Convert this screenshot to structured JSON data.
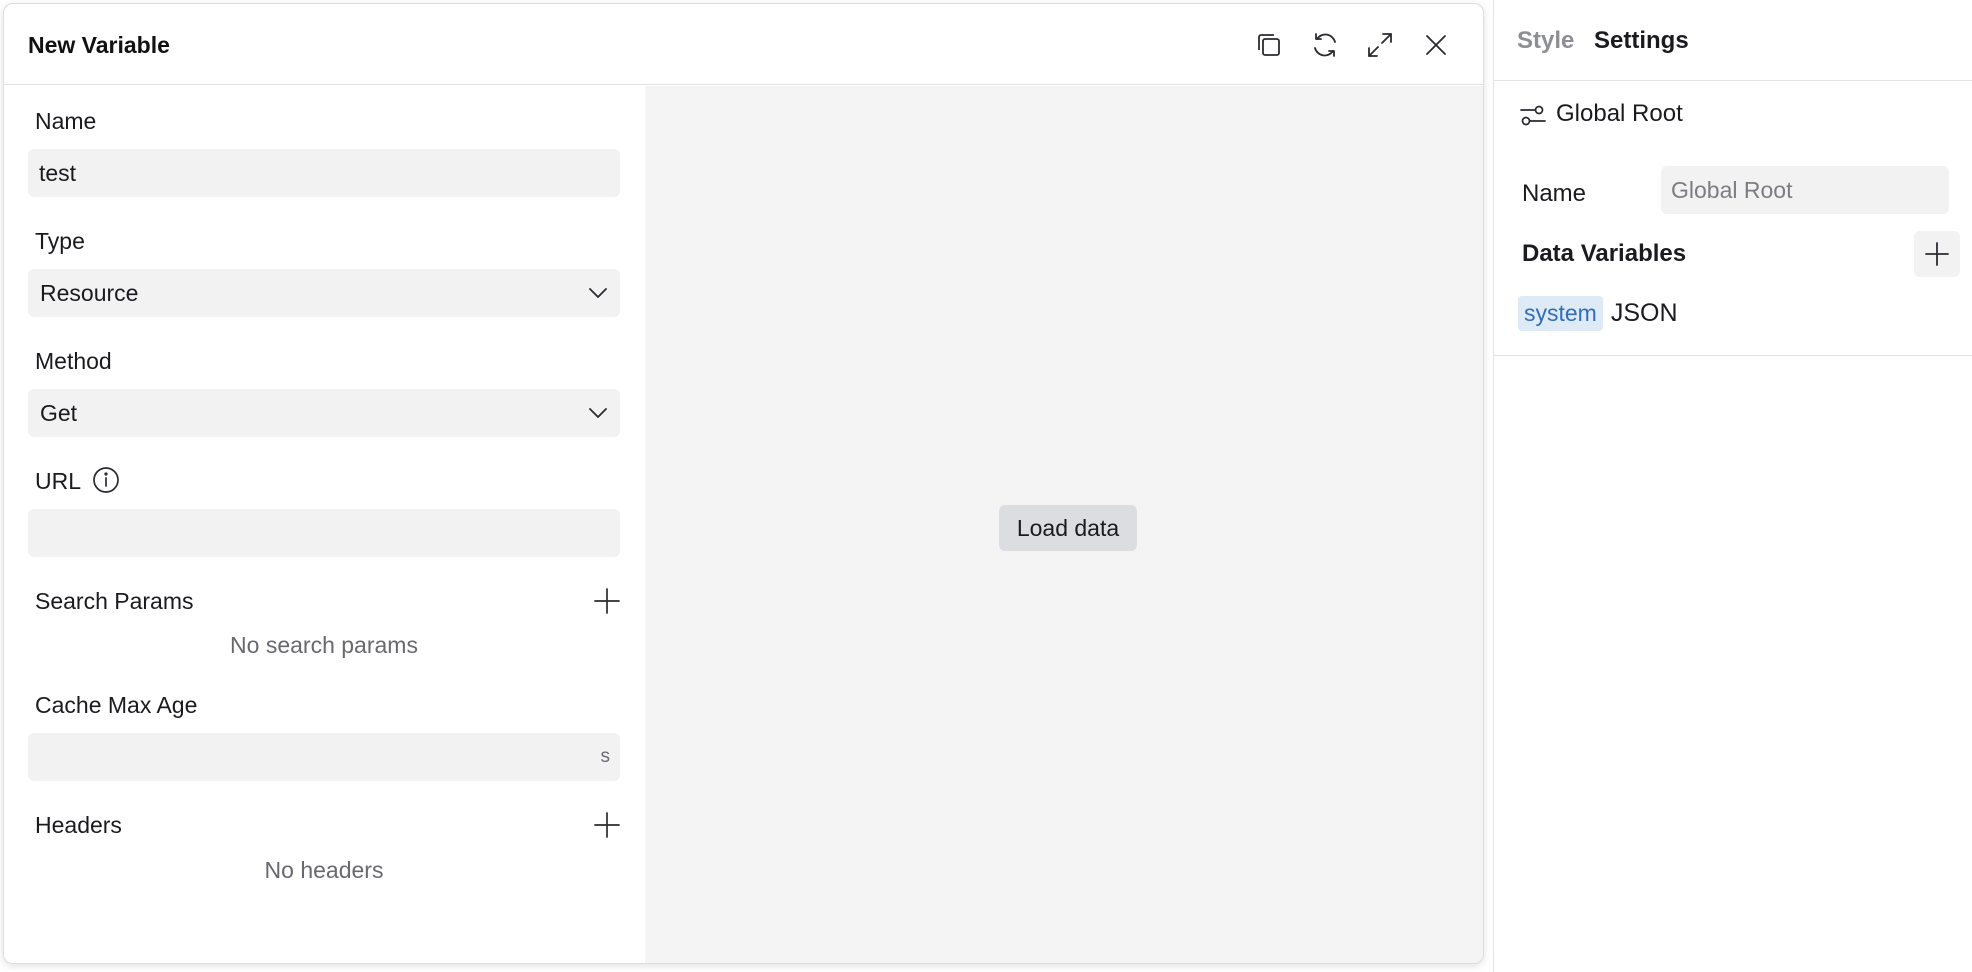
{
  "dialog": {
    "title": "New Variable",
    "form": {
      "name_label": "Name",
      "name_value": "test",
      "type_label": "Type",
      "type_value": "Resource",
      "method_label": "Method",
      "method_value": "Get",
      "url_label": "URL",
      "url_value": "",
      "search_params_label": "Search Params",
      "search_params_empty": "No search params",
      "cache_label": "Cache Max Age",
      "cache_value": "",
      "cache_suffix": "s",
      "headers_label": "Headers",
      "headers_empty": "No headers"
    },
    "preview": {
      "load_label": "Load data"
    },
    "header_icons": [
      "copy-icon",
      "refresh-icon",
      "expand-icon",
      "close-icon"
    ]
  },
  "panel": {
    "tabs": [
      "Style",
      "Settings"
    ],
    "active_tab": "Settings",
    "node_title": "Global Root",
    "name_label": "Name",
    "name_value": "Global Root",
    "data_vars_title": "Data Variables",
    "variables": [
      {
        "badge": "system",
        "name": "JSON"
      }
    ]
  },
  "colors": {
    "badge_bg": "#dfeaf7",
    "badge_text": "#2f6fb8",
    "field_bg": "#f2f2f3",
    "preview_bg": "#f4f4f5"
  }
}
